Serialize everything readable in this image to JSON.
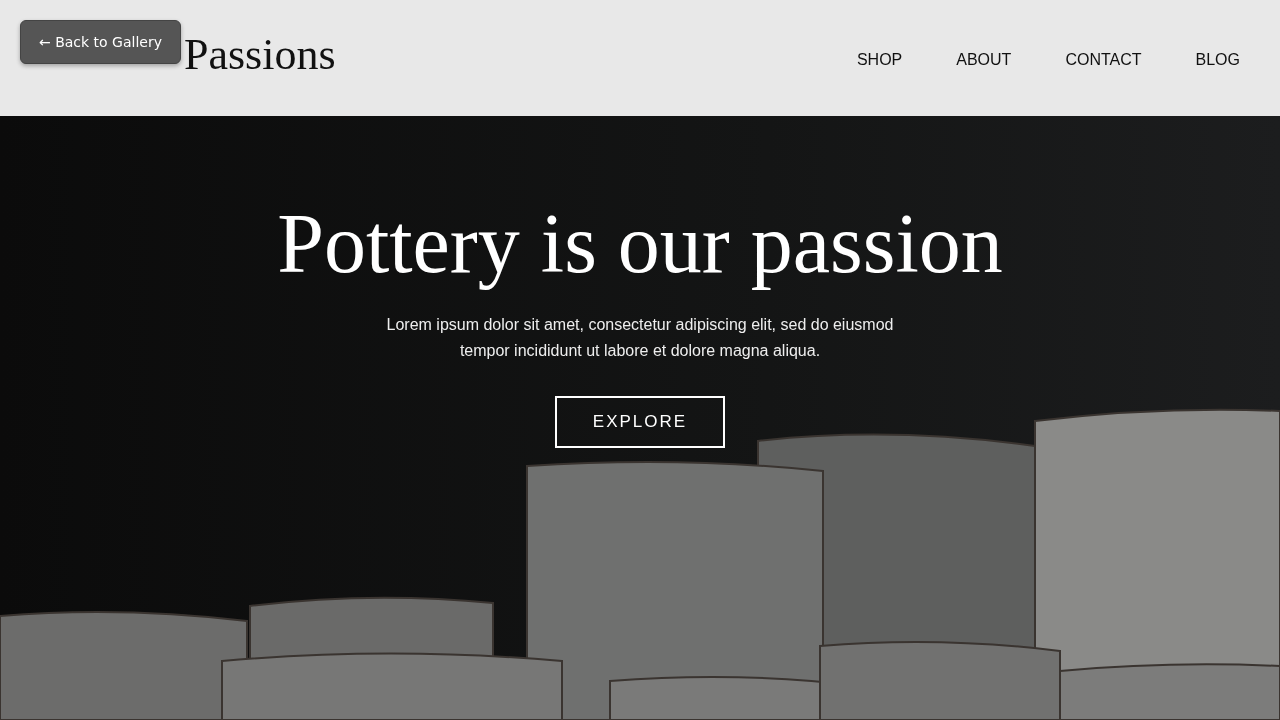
{
  "back_button": {
    "label": "← Back to Gallery"
  },
  "header": {
    "logo": "Passions",
    "nav": [
      {
        "label": "SHOP"
      },
      {
        "label": "ABOUT"
      },
      {
        "label": "CONTACT"
      },
      {
        "label": "BLOG"
      }
    ]
  },
  "hero": {
    "title": "Pottery is our passion",
    "text": "Lorem ipsum dolor sit amet, consectetur adipiscing elit, sed do eiusmod tempor incididunt ut labore et dolore magna aliqua.",
    "button": "EXPLORE"
  }
}
